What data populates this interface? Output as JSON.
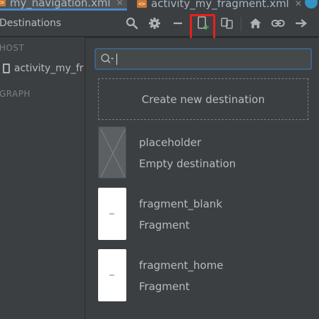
{
  "tabs": [
    {
      "label": "my_navigation.xml",
      "active": true
    },
    {
      "label": "activity_my_fragment.xml",
      "active": false
    }
  ],
  "toolbar": {
    "title": "Destinations",
    "icons": [
      "search-icon",
      "gear-icon",
      "minus-icon",
      "new-destination-icon",
      "nested-graph-icon",
      "home-icon",
      "link-icon",
      "arrow-right-icon"
    ]
  },
  "left_panel": {
    "host_label": "HOST",
    "host_item": "activity_my_fr",
    "graph_label": "GRAPH"
  },
  "popup": {
    "search_value": "",
    "create_label": "Create new destination",
    "destinations": [
      {
        "name": "placeholder",
        "type": "Empty destination",
        "thumb": "placeholder"
      },
      {
        "name": "fragment_blank",
        "type": "Fragment",
        "thumb": "fragment"
      },
      {
        "name": "fragment_home",
        "type": "Fragment",
        "thumb": "fragment"
      }
    ]
  },
  "colors": {
    "highlight": "#e81f1f",
    "accent": "#4a88c7",
    "panel": "#3c3f41"
  }
}
